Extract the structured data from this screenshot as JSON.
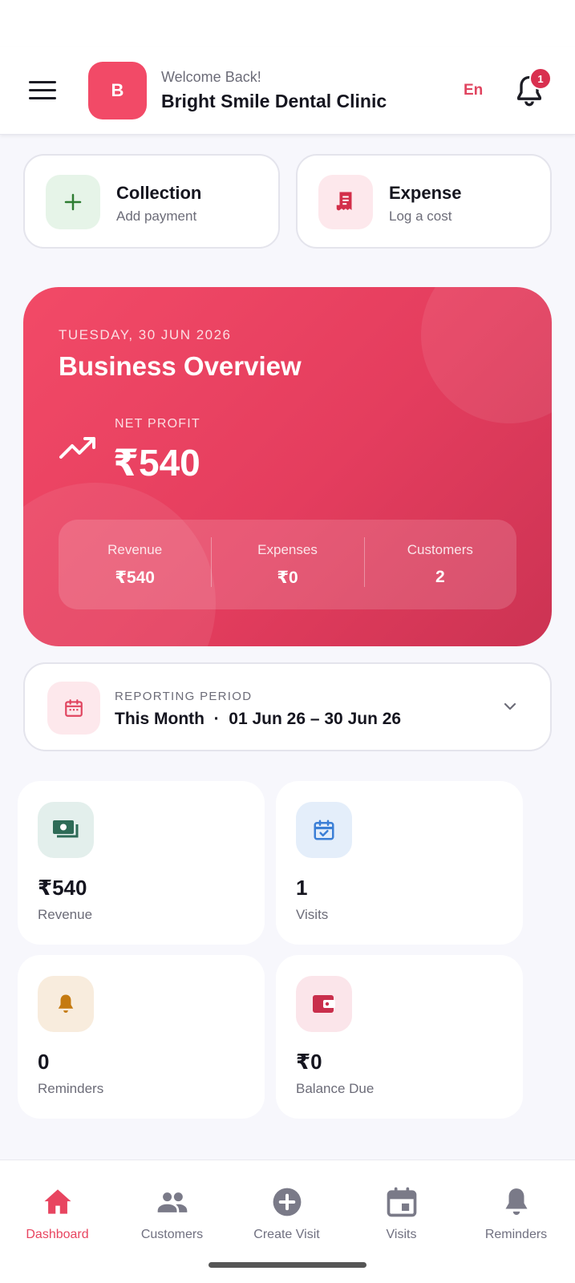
{
  "header": {
    "menu_icon": "hamburger-menu-icon",
    "logo_letter": "B",
    "welcome": "Welcome Back!",
    "clinic_name": "Bright Smile Dental Clinic",
    "language": "En",
    "notification_icon": "bell-icon",
    "notification_count": "1"
  },
  "quick_actions": [
    {
      "title": "Collection",
      "subtitle": "Add payment",
      "icon": "plus-icon"
    },
    {
      "title": "Expense",
      "subtitle": "Log a cost",
      "icon": "receipt-icon"
    }
  ],
  "overview": {
    "date": "TUESDAY, 30 JUN 2026",
    "title": "Business Overview",
    "net_profit_label": "NET PROFIT",
    "net_profit_value": "₹540",
    "stats": [
      {
        "label": "Revenue",
        "value": "₹540"
      },
      {
        "label": "Expenses",
        "value": "₹0"
      },
      {
        "label": "Customers",
        "value": "2"
      }
    ]
  },
  "period": {
    "label": "REPORTING PERIOD",
    "value": "This Month  ·  01 Jun 26 – 30 Jun 26"
  },
  "stats": [
    {
      "value": "₹540",
      "label": "Revenue",
      "icon": "cash-icon"
    },
    {
      "value": "1",
      "label": "Visits",
      "icon": "calendar-check-icon"
    },
    {
      "value": "0",
      "label": "Reminders",
      "icon": "bell-icon"
    },
    {
      "value": "₹0",
      "label": "Balance Due",
      "icon": "wallet-icon"
    }
  ],
  "nav": [
    {
      "label": "Dashboard",
      "icon": "home-icon",
      "active": true
    },
    {
      "label": "Customers",
      "icon": "people-icon"
    },
    {
      "label": "Create Visit",
      "icon": "add-circle-icon"
    },
    {
      "label": "Visits",
      "icon": "calendar-icon"
    },
    {
      "label": "Reminders",
      "icon": "bell-icon"
    }
  ],
  "colors": {
    "brand": "#f24a67",
    "accent_text": "#e84560",
    "background": "#f7f7fc"
  }
}
